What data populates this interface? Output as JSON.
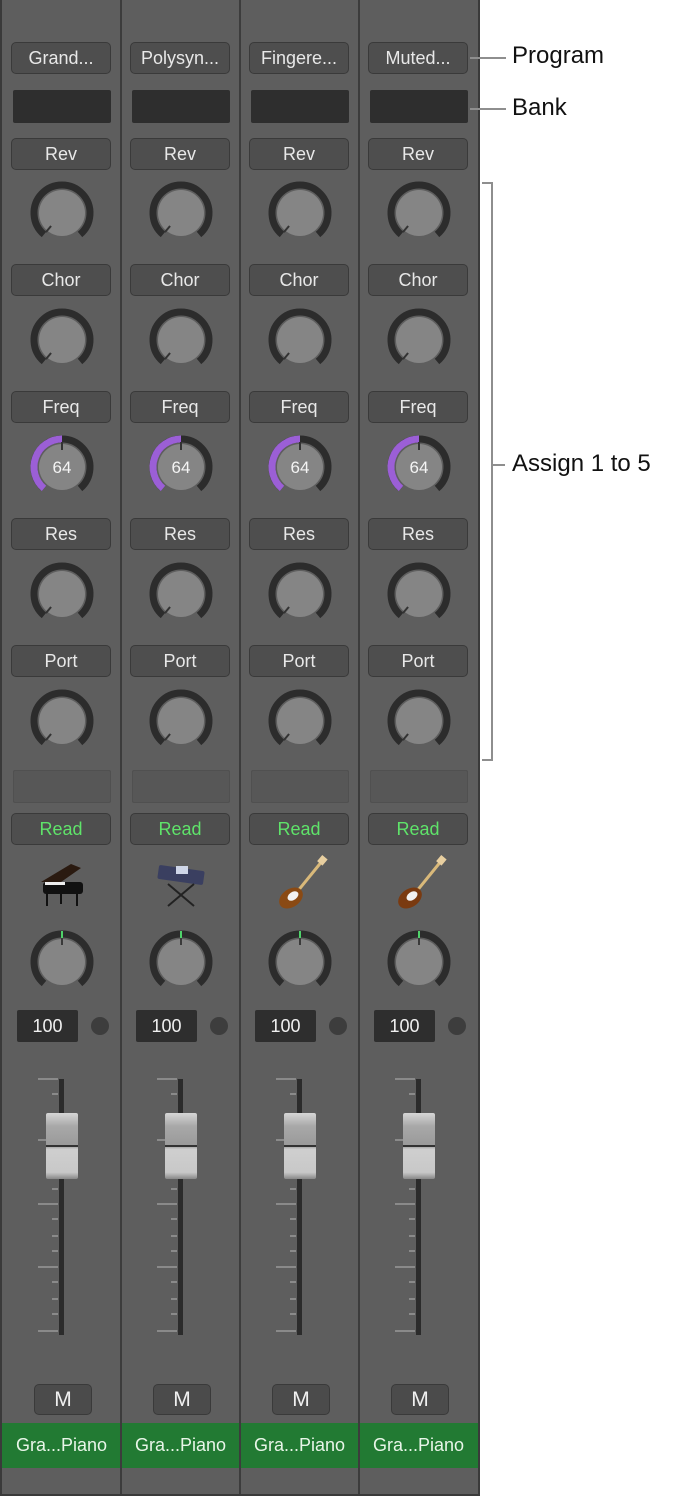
{
  "strips": [
    {
      "program": "Grand...",
      "bank": "",
      "assign": [
        {
          "label": "Rev",
          "value": null,
          "fill": 0
        },
        {
          "label": "Chor",
          "value": null,
          "fill": 0
        },
        {
          "label": "Freq",
          "value": "64",
          "fill": 0.5
        },
        {
          "label": "Res",
          "value": null,
          "fill": 0
        },
        {
          "label": "Port",
          "value": null,
          "fill": 0
        }
      ],
      "automation": "Read",
      "instrument_icon": "grand-piano-icon",
      "pan_value": 0.5,
      "volume": "100",
      "fader_level": 0.82,
      "mute_label": "M",
      "track_name": "Gra...Piano"
    },
    {
      "program": "Polysyn...",
      "bank": "",
      "assign": [
        {
          "label": "Rev",
          "value": null,
          "fill": 0
        },
        {
          "label": "Chor",
          "value": null,
          "fill": 0
        },
        {
          "label": "Freq",
          "value": "64",
          "fill": 0.5
        },
        {
          "label": "Res",
          "value": null,
          "fill": 0
        },
        {
          "label": "Port",
          "value": null,
          "fill": 0
        }
      ],
      "automation": "Read",
      "instrument_icon": "synthesizer-keyboard-icon",
      "pan_value": 0.5,
      "volume": "100",
      "fader_level": 0.82,
      "mute_label": "M",
      "track_name": "Gra...Piano"
    },
    {
      "program": "Fingere...",
      "bank": "",
      "assign": [
        {
          "label": "Rev",
          "value": null,
          "fill": 0
        },
        {
          "label": "Chor",
          "value": null,
          "fill": 0
        },
        {
          "label": "Freq",
          "value": "64",
          "fill": 0.5
        },
        {
          "label": "Res",
          "value": null,
          "fill": 0
        },
        {
          "label": "Port",
          "value": null,
          "fill": 0
        }
      ],
      "automation": "Read",
      "instrument_icon": "bass-guitar-icon",
      "pan_value": 0.5,
      "volume": "100",
      "fader_level": 0.82,
      "mute_label": "M",
      "track_name": "Gra...Piano"
    },
    {
      "program": "Muted...",
      "bank": "",
      "assign": [
        {
          "label": "Rev",
          "value": null,
          "fill": 0
        },
        {
          "label": "Chor",
          "value": null,
          "fill": 0
        },
        {
          "label": "Freq",
          "value": "64",
          "fill": 0.5
        },
        {
          "label": "Res",
          "value": null,
          "fill": 0
        },
        {
          "label": "Port",
          "value": null,
          "fill": 0
        }
      ],
      "automation": "Read",
      "instrument_icon": "electric-guitar-icon",
      "pan_value": 0.5,
      "volume": "100",
      "fader_level": 0.82,
      "mute_label": "M",
      "track_name": "Gra...Piano"
    }
  ],
  "callouts": {
    "program": "Program",
    "bank": "Bank",
    "assign": "Assign 1 to 5"
  },
  "colors": {
    "freq_arc": "#9b5fd6",
    "automation_read": "#5fe36a",
    "track_name_bg": "#227a33",
    "pan_indicator": "#4fd36a"
  }
}
